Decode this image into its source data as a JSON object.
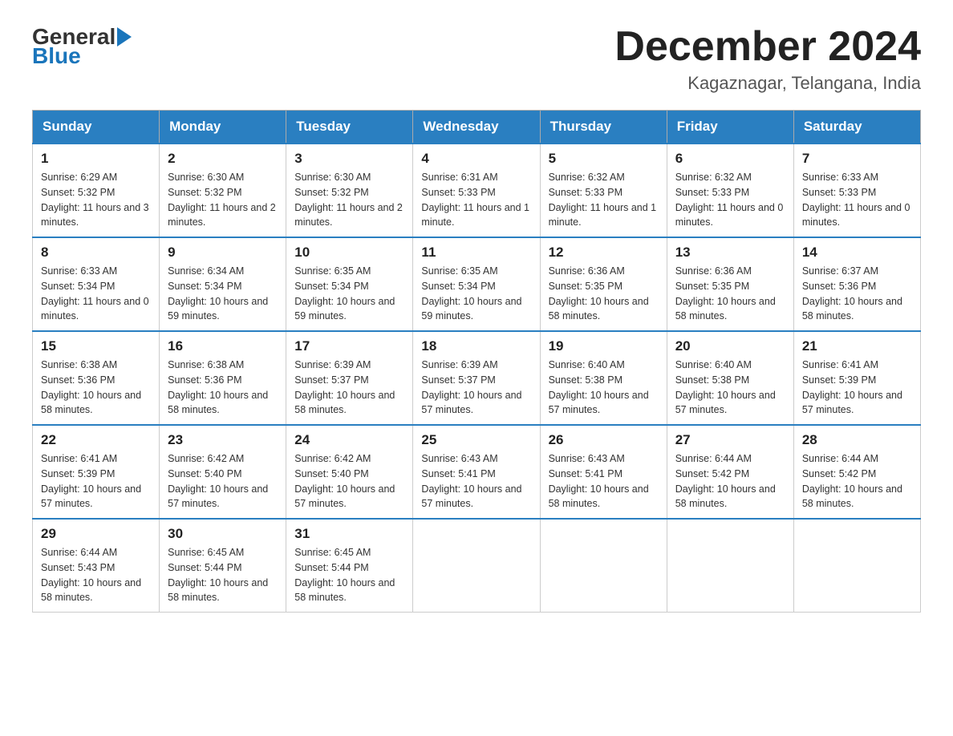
{
  "header": {
    "logo_general": "General",
    "logo_blue": "Blue",
    "month_year": "December 2024",
    "location": "Kagaznagar, Telangana, India"
  },
  "days_of_week": [
    "Sunday",
    "Monday",
    "Tuesday",
    "Wednesday",
    "Thursday",
    "Friday",
    "Saturday"
  ],
  "weeks": [
    [
      {
        "day": "1",
        "sunrise": "6:29 AM",
        "sunset": "5:32 PM",
        "daylight": "11 hours and 3 minutes."
      },
      {
        "day": "2",
        "sunrise": "6:30 AM",
        "sunset": "5:32 PM",
        "daylight": "11 hours and 2 minutes."
      },
      {
        "day": "3",
        "sunrise": "6:30 AM",
        "sunset": "5:32 PM",
        "daylight": "11 hours and 2 minutes."
      },
      {
        "day": "4",
        "sunrise": "6:31 AM",
        "sunset": "5:33 PM",
        "daylight": "11 hours and 1 minute."
      },
      {
        "day": "5",
        "sunrise": "6:32 AM",
        "sunset": "5:33 PM",
        "daylight": "11 hours and 1 minute."
      },
      {
        "day": "6",
        "sunrise": "6:32 AM",
        "sunset": "5:33 PM",
        "daylight": "11 hours and 0 minutes."
      },
      {
        "day": "7",
        "sunrise": "6:33 AM",
        "sunset": "5:33 PM",
        "daylight": "11 hours and 0 minutes."
      }
    ],
    [
      {
        "day": "8",
        "sunrise": "6:33 AM",
        "sunset": "5:34 PM",
        "daylight": "11 hours and 0 minutes."
      },
      {
        "day": "9",
        "sunrise": "6:34 AM",
        "sunset": "5:34 PM",
        "daylight": "10 hours and 59 minutes."
      },
      {
        "day": "10",
        "sunrise": "6:35 AM",
        "sunset": "5:34 PM",
        "daylight": "10 hours and 59 minutes."
      },
      {
        "day": "11",
        "sunrise": "6:35 AM",
        "sunset": "5:34 PM",
        "daylight": "10 hours and 59 minutes."
      },
      {
        "day": "12",
        "sunrise": "6:36 AM",
        "sunset": "5:35 PM",
        "daylight": "10 hours and 58 minutes."
      },
      {
        "day": "13",
        "sunrise": "6:36 AM",
        "sunset": "5:35 PM",
        "daylight": "10 hours and 58 minutes."
      },
      {
        "day": "14",
        "sunrise": "6:37 AM",
        "sunset": "5:36 PM",
        "daylight": "10 hours and 58 minutes."
      }
    ],
    [
      {
        "day": "15",
        "sunrise": "6:38 AM",
        "sunset": "5:36 PM",
        "daylight": "10 hours and 58 minutes."
      },
      {
        "day": "16",
        "sunrise": "6:38 AM",
        "sunset": "5:36 PM",
        "daylight": "10 hours and 58 minutes."
      },
      {
        "day": "17",
        "sunrise": "6:39 AM",
        "sunset": "5:37 PM",
        "daylight": "10 hours and 58 minutes."
      },
      {
        "day": "18",
        "sunrise": "6:39 AM",
        "sunset": "5:37 PM",
        "daylight": "10 hours and 57 minutes."
      },
      {
        "day": "19",
        "sunrise": "6:40 AM",
        "sunset": "5:38 PM",
        "daylight": "10 hours and 57 minutes."
      },
      {
        "day": "20",
        "sunrise": "6:40 AM",
        "sunset": "5:38 PM",
        "daylight": "10 hours and 57 minutes."
      },
      {
        "day": "21",
        "sunrise": "6:41 AM",
        "sunset": "5:39 PM",
        "daylight": "10 hours and 57 minutes."
      }
    ],
    [
      {
        "day": "22",
        "sunrise": "6:41 AM",
        "sunset": "5:39 PM",
        "daylight": "10 hours and 57 minutes."
      },
      {
        "day": "23",
        "sunrise": "6:42 AM",
        "sunset": "5:40 PM",
        "daylight": "10 hours and 57 minutes."
      },
      {
        "day": "24",
        "sunrise": "6:42 AM",
        "sunset": "5:40 PM",
        "daylight": "10 hours and 57 minutes."
      },
      {
        "day": "25",
        "sunrise": "6:43 AM",
        "sunset": "5:41 PM",
        "daylight": "10 hours and 57 minutes."
      },
      {
        "day": "26",
        "sunrise": "6:43 AM",
        "sunset": "5:41 PM",
        "daylight": "10 hours and 58 minutes."
      },
      {
        "day": "27",
        "sunrise": "6:44 AM",
        "sunset": "5:42 PM",
        "daylight": "10 hours and 58 minutes."
      },
      {
        "day": "28",
        "sunrise": "6:44 AM",
        "sunset": "5:42 PM",
        "daylight": "10 hours and 58 minutes."
      }
    ],
    [
      {
        "day": "29",
        "sunrise": "6:44 AM",
        "sunset": "5:43 PM",
        "daylight": "10 hours and 58 minutes."
      },
      {
        "day": "30",
        "sunrise": "6:45 AM",
        "sunset": "5:44 PM",
        "daylight": "10 hours and 58 minutes."
      },
      {
        "day": "31",
        "sunrise": "6:45 AM",
        "sunset": "5:44 PM",
        "daylight": "10 hours and 58 minutes."
      },
      null,
      null,
      null,
      null
    ]
  ]
}
